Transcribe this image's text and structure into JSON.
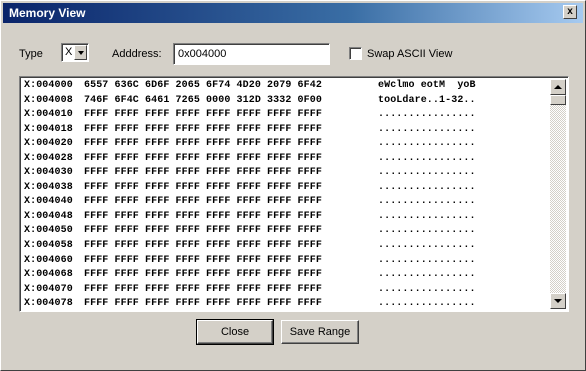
{
  "window": {
    "title": "Memory View",
    "close_glyph": "x"
  },
  "controls": {
    "type_label": "Type",
    "type_value": "X",
    "address_label": "Adddress:",
    "address_value": "0x004000",
    "swap_label": "Swap ASCII View",
    "swap_checked": false
  },
  "memory": {
    "rows": [
      {
        "addr": "X:004000",
        "hex": "6557 636C 6D6F 2065 6F74 4D20 2079 6F42",
        "ascii": "eWclmo eotM  yoB"
      },
      {
        "addr": "X:004008",
        "hex": "746F 6F4C 6461 7265 0000 312D 3332 0F00",
        "ascii": "tooLdare..1-32.."
      },
      {
        "addr": "X:004010",
        "hex": "FFFF FFFF FFFF FFFF FFFF FFFF FFFF FFFF",
        "ascii": "................"
      },
      {
        "addr": "X:004018",
        "hex": "FFFF FFFF FFFF FFFF FFFF FFFF FFFF FFFF",
        "ascii": "................"
      },
      {
        "addr": "X:004020",
        "hex": "FFFF FFFF FFFF FFFF FFFF FFFF FFFF FFFF",
        "ascii": "................"
      },
      {
        "addr": "X:004028",
        "hex": "FFFF FFFF FFFF FFFF FFFF FFFF FFFF FFFF",
        "ascii": "................"
      },
      {
        "addr": "X:004030",
        "hex": "FFFF FFFF FFFF FFFF FFFF FFFF FFFF FFFF",
        "ascii": "................"
      },
      {
        "addr": "X:004038",
        "hex": "FFFF FFFF FFFF FFFF FFFF FFFF FFFF FFFF",
        "ascii": "................"
      },
      {
        "addr": "X:004040",
        "hex": "FFFF FFFF FFFF FFFF FFFF FFFF FFFF FFFF",
        "ascii": "................"
      },
      {
        "addr": "X:004048",
        "hex": "FFFF FFFF FFFF FFFF FFFF FFFF FFFF FFFF",
        "ascii": "................"
      },
      {
        "addr": "X:004050",
        "hex": "FFFF FFFF FFFF FFFF FFFF FFFF FFFF FFFF",
        "ascii": "................"
      },
      {
        "addr": "X:004058",
        "hex": "FFFF FFFF FFFF FFFF FFFF FFFF FFFF FFFF",
        "ascii": "................"
      },
      {
        "addr": "X:004060",
        "hex": "FFFF FFFF FFFF FFFF FFFF FFFF FFFF FFFF",
        "ascii": "................"
      },
      {
        "addr": "X:004068",
        "hex": "FFFF FFFF FFFF FFFF FFFF FFFF FFFF FFFF",
        "ascii": "................"
      },
      {
        "addr": "X:004070",
        "hex": "FFFF FFFF FFFF FFFF FFFF FFFF FFFF FFFF",
        "ascii": "................"
      },
      {
        "addr": "X:004078",
        "hex": "FFFF FFFF FFFF FFFF FFFF FFFF FFFF FFFF",
        "ascii": "................"
      }
    ]
  },
  "buttons": {
    "close_label": "Close",
    "save_range_label": "Save Range"
  },
  "icons": {
    "window_close": "close-icon",
    "combo": "chevron-down-icon",
    "scroll_up": "arrow-up-icon",
    "scroll_down": "arrow-down-icon"
  },
  "colors": {
    "title_gradient_start": "#0a246a",
    "title_gradient_end": "#a6caf0",
    "face": "#d4d0c8"
  }
}
